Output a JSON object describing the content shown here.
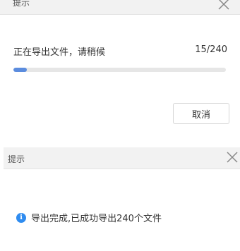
{
  "export_dialog": {
    "title": "提示",
    "message": "正在导出文件，请稍候",
    "progress": {
      "current": 15,
      "total": 240,
      "label": "15/240"
    },
    "cancel_label": "取消",
    "accent_color": "#5b8cde"
  },
  "complete_dialog": {
    "title": "提示",
    "message": "导出完成,已成功导出240个文件",
    "icon": "info-icon",
    "icon_color": "#2f8cf0"
  }
}
